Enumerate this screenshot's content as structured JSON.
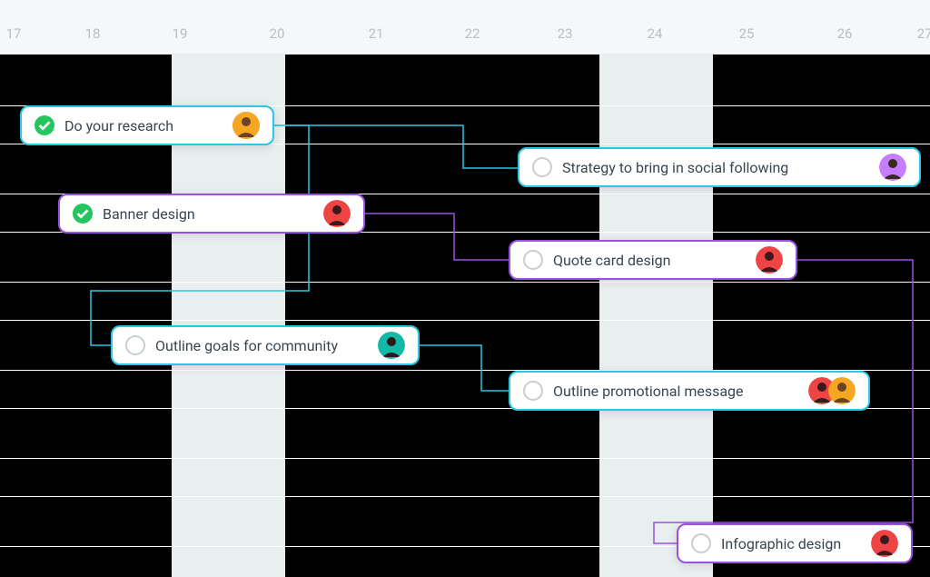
{
  "timeline": {
    "days": [
      "17",
      "18",
      "19",
      "20",
      "21",
      "22",
      "23",
      "24",
      "25",
      "26",
      "27"
    ],
    "weekend_columns": [
      {
        "start_day": "19",
        "end_day": "20"
      },
      {
        "start_day": "24",
        "end_day": "24"
      }
    ]
  },
  "tasks": {
    "research": {
      "title": "Do your research",
      "done": true
    },
    "banner": {
      "title": "Banner design",
      "done": true
    },
    "strategy": {
      "title": "Strategy to bring in social following",
      "done": false
    },
    "quote": {
      "title": "Quote card design",
      "done": false
    },
    "goals": {
      "title": "Outline goals for community",
      "done": false
    },
    "promo": {
      "title": "Outline promotional message",
      "done": false
    },
    "infographic": {
      "title": "Infographic design",
      "done": false
    }
  },
  "colors": {
    "cyan": "#2ac7e4",
    "purple": "#9b51e0",
    "done": "#22c55e"
  }
}
